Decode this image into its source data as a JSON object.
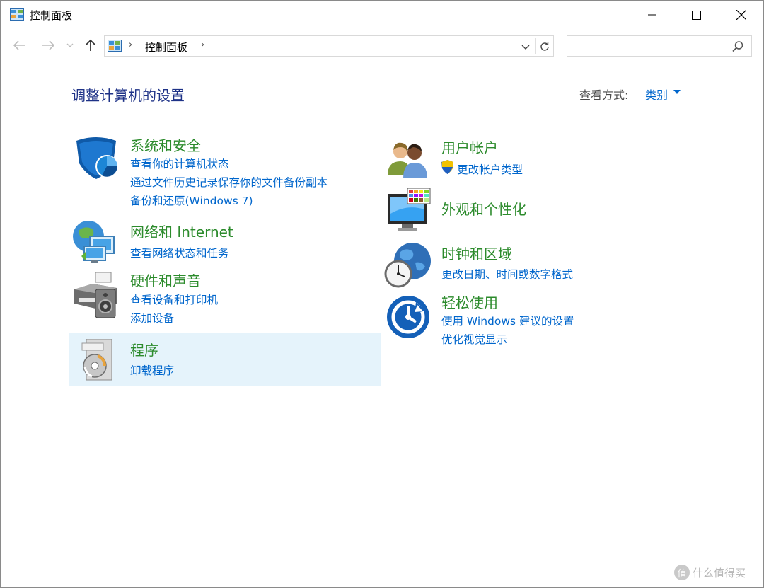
{
  "window": {
    "title": "控制面板",
    "icon": "control-panel-icon"
  },
  "titlebar_buttons": [
    "minimize-icon",
    "maximize-icon",
    "close-icon"
  ],
  "navigation": {
    "back_icon": "back-arrow-icon",
    "forward_icon": "forward-arrow-icon",
    "recent_icon": "chevron-down-icon",
    "up_icon": "up-arrow-icon"
  },
  "address_bar": {
    "breadcrumb": "控制面板",
    "separator": "›"
  },
  "search": {
    "placeholder": "",
    "value": ""
  },
  "header": {
    "title": "调整计算机的设置",
    "view_by_label": "查看方式:",
    "view_by_value": "类别"
  },
  "categories": {
    "system_security": {
      "title": "系统和安全",
      "links": [
        "查看你的计算机状态",
        "通过文件历史记录保存你的文件备份副本",
        "备份和还原(Windows 7)"
      ]
    },
    "network": {
      "title": "网络和 Internet",
      "links": [
        "查看网络状态和任务"
      ]
    },
    "hardware": {
      "title": "硬件和声音",
      "links": [
        "查看设备和打印机",
        "添加设备"
      ]
    },
    "programs": {
      "title": "程序",
      "links": [
        "卸载程序"
      ]
    },
    "user_accounts": {
      "title": "用户帐户",
      "links": [
        "更改帐户类型"
      ]
    },
    "appearance": {
      "title": "外观和个性化",
      "links": []
    },
    "clock_region": {
      "title": "时钟和区域",
      "links": [
        "更改日期、时间或数字格式"
      ]
    },
    "ease_of_access": {
      "title": "轻松使用",
      "links": [
        "使用 Windows 建议的设置",
        "优化视觉显示"
      ]
    }
  },
  "colors": {
    "title_blue": "#1e3287",
    "category_green": "#2c8b2c",
    "link_blue": "#0066cc",
    "hover_bg": "#e5f3fb"
  },
  "watermark": {
    "badge": "值",
    "text": "什么值得买"
  }
}
